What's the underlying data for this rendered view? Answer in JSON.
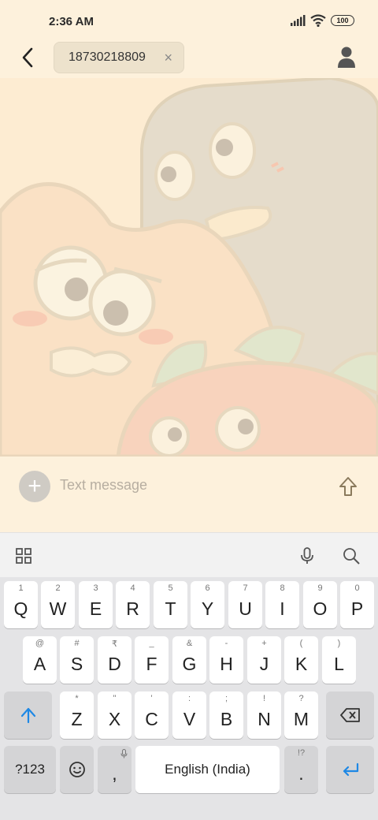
{
  "status": {
    "time": "2:36 AM",
    "battery": "100"
  },
  "header": {
    "recipient": "18730218809",
    "chip_close": "×"
  },
  "compose": {
    "attach": "+",
    "placeholder": "Text message"
  },
  "keyboard": {
    "row1": [
      {
        "label": "Q",
        "hint": "1"
      },
      {
        "label": "W",
        "hint": "2"
      },
      {
        "label": "E",
        "hint": "3"
      },
      {
        "label": "R",
        "hint": "4"
      },
      {
        "label": "T",
        "hint": "5"
      },
      {
        "label": "Y",
        "hint": "6"
      },
      {
        "label": "U",
        "hint": "7"
      },
      {
        "label": "I",
        "hint": "8"
      },
      {
        "label": "O",
        "hint": "9"
      },
      {
        "label": "P",
        "hint": "0"
      }
    ],
    "row2": [
      {
        "label": "A",
        "hint": "@"
      },
      {
        "label": "S",
        "hint": "#"
      },
      {
        "label": "D",
        "hint": "₹"
      },
      {
        "label": "F",
        "hint": "_"
      },
      {
        "label": "G",
        "hint": "&"
      },
      {
        "label": "H",
        "hint": "-"
      },
      {
        "label": "J",
        "hint": "+"
      },
      {
        "label": "K",
        "hint": "("
      },
      {
        "label": "L",
        "hint": ")"
      }
    ],
    "row3": [
      {
        "label": "Z",
        "hint": "*"
      },
      {
        "label": "X",
        "hint": "\""
      },
      {
        "label": "C",
        "hint": "'"
      },
      {
        "label": "V",
        "hint": ":"
      },
      {
        "label": "B",
        "hint": ";"
      },
      {
        "label": "N",
        "hint": "!"
      },
      {
        "label": "M",
        "hint": "?"
      }
    ],
    "symbols_key": "?123",
    "comma": ",",
    "space": "English (India)",
    "period": ".",
    "period_hint": "!?"
  },
  "colors": {
    "accent": "#2196f3",
    "background": "#fdf1dc"
  },
  "icons": [
    "signal-icon",
    "wifi-icon",
    "battery-icon",
    "back-arrow-icon",
    "close-icon",
    "contact-icon",
    "plus-icon",
    "send-arrow-icon",
    "grid-icon",
    "microphone-icon",
    "search-icon",
    "shift-icon",
    "backspace-icon",
    "emoji-icon",
    "enter-icon"
  ]
}
